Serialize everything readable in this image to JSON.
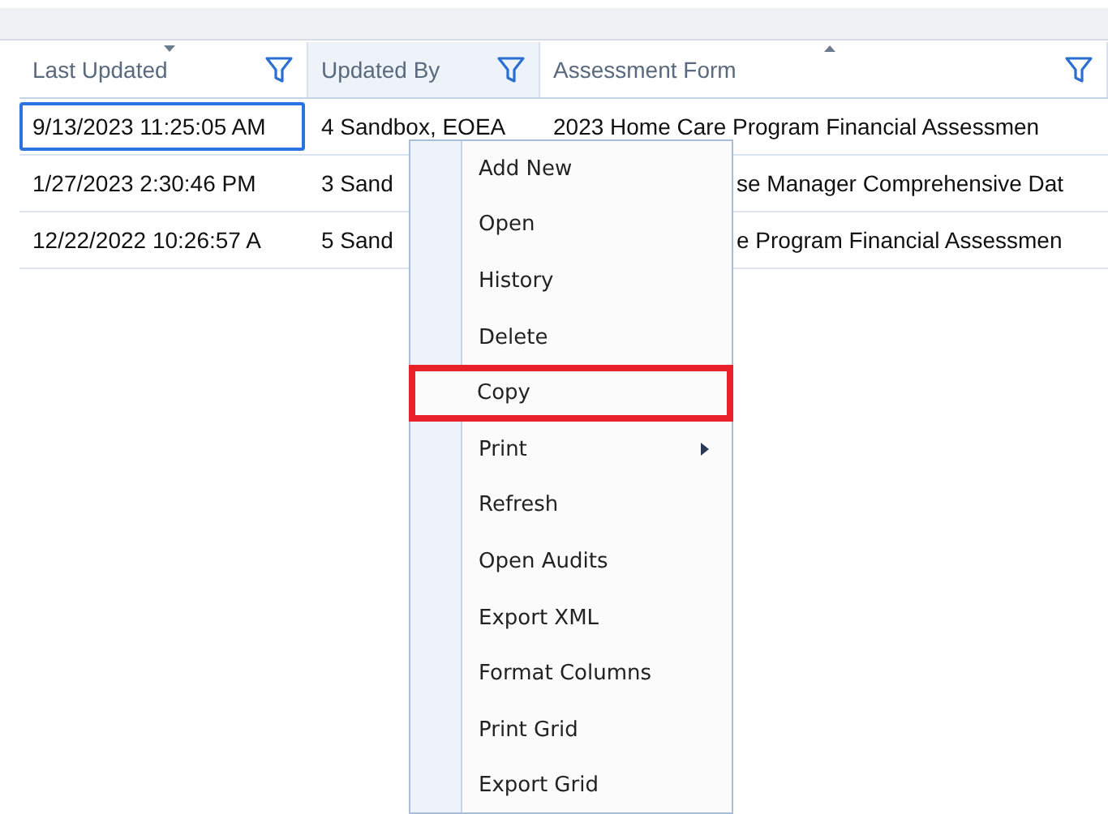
{
  "table": {
    "columns": [
      {
        "label": "Last Updated",
        "sorted": true,
        "ascending": false
      },
      {
        "label": "Updated By",
        "sorted": false
      },
      {
        "label": "Assessment Form",
        "sorted": true,
        "ascending": true
      }
    ],
    "rows": [
      {
        "cells": [
          {
            "text": "9/13/2023 11:25:05 AM",
            "kind": "plain",
            "selected": true
          },
          {
            "text": "4 Sandbox, EOEA",
            "kind": "plain",
            "selected": false
          },
          {
            "text": "2023 Home Care Program Financial Assessmen",
            "kind": "plain",
            "selected": false
          }
        ]
      },
      {
        "cells": [
          {
            "text": "1/27/2023 2:30:46 PM",
            "kind": "plain",
            "selected": false
          },
          {
            "text": "3 Sand",
            "kind": "plain",
            "selected": false
          },
          {
            "text": "se Manager Comprehensive Dat",
            "kind": "behind_menu",
            "selected": false
          }
        ]
      },
      {
        "cells": [
          {
            "text": "12/22/2022 10:26:57 A",
            "kind": "plain",
            "selected": false
          },
          {
            "text": "5 Sand",
            "kind": "plain",
            "selected": false
          },
          {
            "text": "e Program Financial Assessmen",
            "kind": "behind_menu",
            "selected": false
          }
        ]
      }
    ]
  },
  "context_menu": {
    "items": [
      {
        "label": "Add New",
        "highlighted": false,
        "submenu": false
      },
      {
        "label": "Open",
        "highlighted": false,
        "submenu": false
      },
      {
        "label": "History",
        "highlighted": false,
        "submenu": false
      },
      {
        "label": "Delete",
        "highlighted": false,
        "submenu": false
      },
      {
        "label": "Copy",
        "highlighted": true,
        "submenu": false
      },
      {
        "label": "Print",
        "highlighted": false,
        "submenu": true
      },
      {
        "label": "Refresh",
        "highlighted": false,
        "submenu": false
      },
      {
        "label": "Open Audits",
        "highlighted": false,
        "submenu": false
      },
      {
        "label": "Export XML",
        "highlighted": false,
        "submenu": false
      },
      {
        "label": "Format Columns",
        "highlighted": false,
        "submenu": false
      },
      {
        "label": "Print Grid",
        "highlighted": false,
        "submenu": false
      },
      {
        "label": "Export Grid",
        "highlighted": false,
        "submenu": false
      }
    ]
  }
}
